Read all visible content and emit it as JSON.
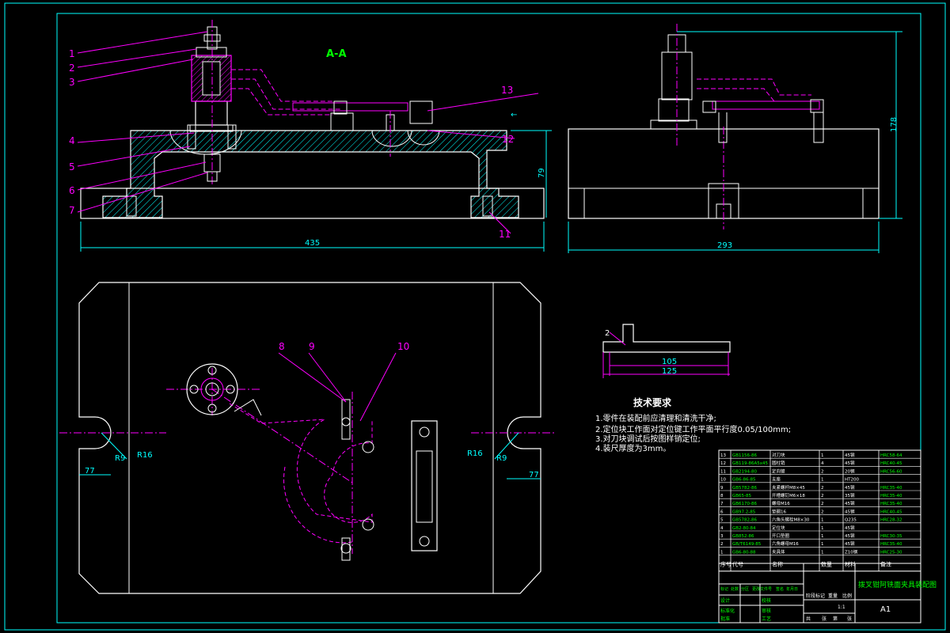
{
  "section_title": "A-A",
  "part_callouts": {
    "c1": "1",
    "c2": "2",
    "c3": "3",
    "c4": "4",
    "c5": "5",
    "c6": "6",
    "c7": "7",
    "c8": "8",
    "c9": "9",
    "c10": "10",
    "c11": "11",
    "c12": "12",
    "c13": "13"
  },
  "dimensions": {
    "front_width": "435",
    "front_height": "79",
    "side_width": "293",
    "side_height": "178",
    "radius_small_left": "R9",
    "radius_big_left": "R16",
    "radius_small_right": "R9",
    "radius_big_right": "R16",
    "offset_left": "77",
    "offset_right": "77",
    "detail_inner": "105",
    "detail_outer": "125",
    "detail_callout": "2"
  },
  "tech_requirements": {
    "title": "技术要求",
    "items": [
      "1.零件在装配前应清理和清洗干净;",
      "2.定位块工作面对定位键工作平面平行度0.05/100mm;",
      "3.对刀块调试后按图样销定位;",
      "4.装尺厚度为3mm。"
    ]
  },
  "bom": {
    "rows": [
      {
        "no": "13",
        "code": "GB1156-86",
        "name": "对刀块",
        "qty": "1",
        "material": "45钢",
        "note": "HRC58-64"
      },
      {
        "no": "12",
        "code": "GB119-86A5x45",
        "name": "圆柱销",
        "qty": "4",
        "material": "45钢",
        "note": "HRC40-45"
      },
      {
        "no": "11",
        "code": "GB2194-80",
        "name": "定向键",
        "qty": "2",
        "material": "20钢",
        "note": "HRC56-60"
      },
      {
        "no": "10",
        "code": "GB6-86-85",
        "name": "支座",
        "qty": "1",
        "material": "HT200",
        "note": ""
      },
      {
        "no": "9",
        "code": "GB5782-86",
        "name": "夹紧螺杆M8×45",
        "qty": "2",
        "material": "45钢",
        "note": "HRC35-40"
      },
      {
        "no": "8",
        "code": "GB65-85",
        "name": "开槽螺钉M6×18",
        "qty": "2",
        "material": "35钢",
        "note": "HRC35-40"
      },
      {
        "no": "7",
        "code": "GB6170-86",
        "name": "螺母M16",
        "qty": "2",
        "material": "45钢",
        "note": "HRC35-40"
      },
      {
        "no": "6",
        "code": "GB97.2-85",
        "name": "垫圈16",
        "qty": "2",
        "material": "45钢",
        "note": "HRC40-45"
      },
      {
        "no": "5",
        "code": "GB5782-86",
        "name": "六角头螺栓M8×30",
        "qty": "1",
        "material": "Q235",
        "note": "HRC28-32"
      },
      {
        "no": "4",
        "code": "GB2-80-84",
        "name": "定位块",
        "qty": "1",
        "material": "45钢",
        "note": ""
      },
      {
        "no": "3",
        "code": "GB852-86",
        "name": "开口垫圈",
        "qty": "1",
        "material": "45钢",
        "note": "HRC30-35"
      },
      {
        "no": "2",
        "code": "GB/T6149-85",
        "name": "六角螺母M16",
        "qty": "1",
        "material": "45钢",
        "note": "HRC35-40"
      },
      {
        "no": "1",
        "code": "GB6-80-88",
        "name": "夹具体",
        "qty": "1",
        "material": "Z10钢",
        "note": "HRC25-30"
      }
    ],
    "header": {
      "no": "序号",
      "code": "代号",
      "name": "名称",
      "qty": "数量",
      "material": "材料",
      "note": "备注"
    }
  },
  "title_block": {
    "drawing_title": "拨叉钳阿铣面夹具装配图",
    "scale_label": "A1",
    "ratio": "1:1",
    "row_labels": [
      "标记",
      "处数",
      "分区",
      "更改文件号",
      "签名",
      "年月日"
    ],
    "left_labels": [
      "设计",
      "校核",
      "审核",
      "工艺",
      "标准化",
      "批准"
    ],
    "stage_labels": [
      "阶段标记",
      "重量",
      "比例"
    ],
    "sheet_labels": [
      "共",
      "张",
      "第",
      "张"
    ]
  },
  "colors": {
    "background": "#000000",
    "frame": "#00ffff",
    "outline": "#ffffff",
    "leader": "#ff00ff",
    "hatch": "#00ffff",
    "dimension": "#00ffff",
    "text_green": "#00ff00",
    "table_line": "#ffffff"
  }
}
